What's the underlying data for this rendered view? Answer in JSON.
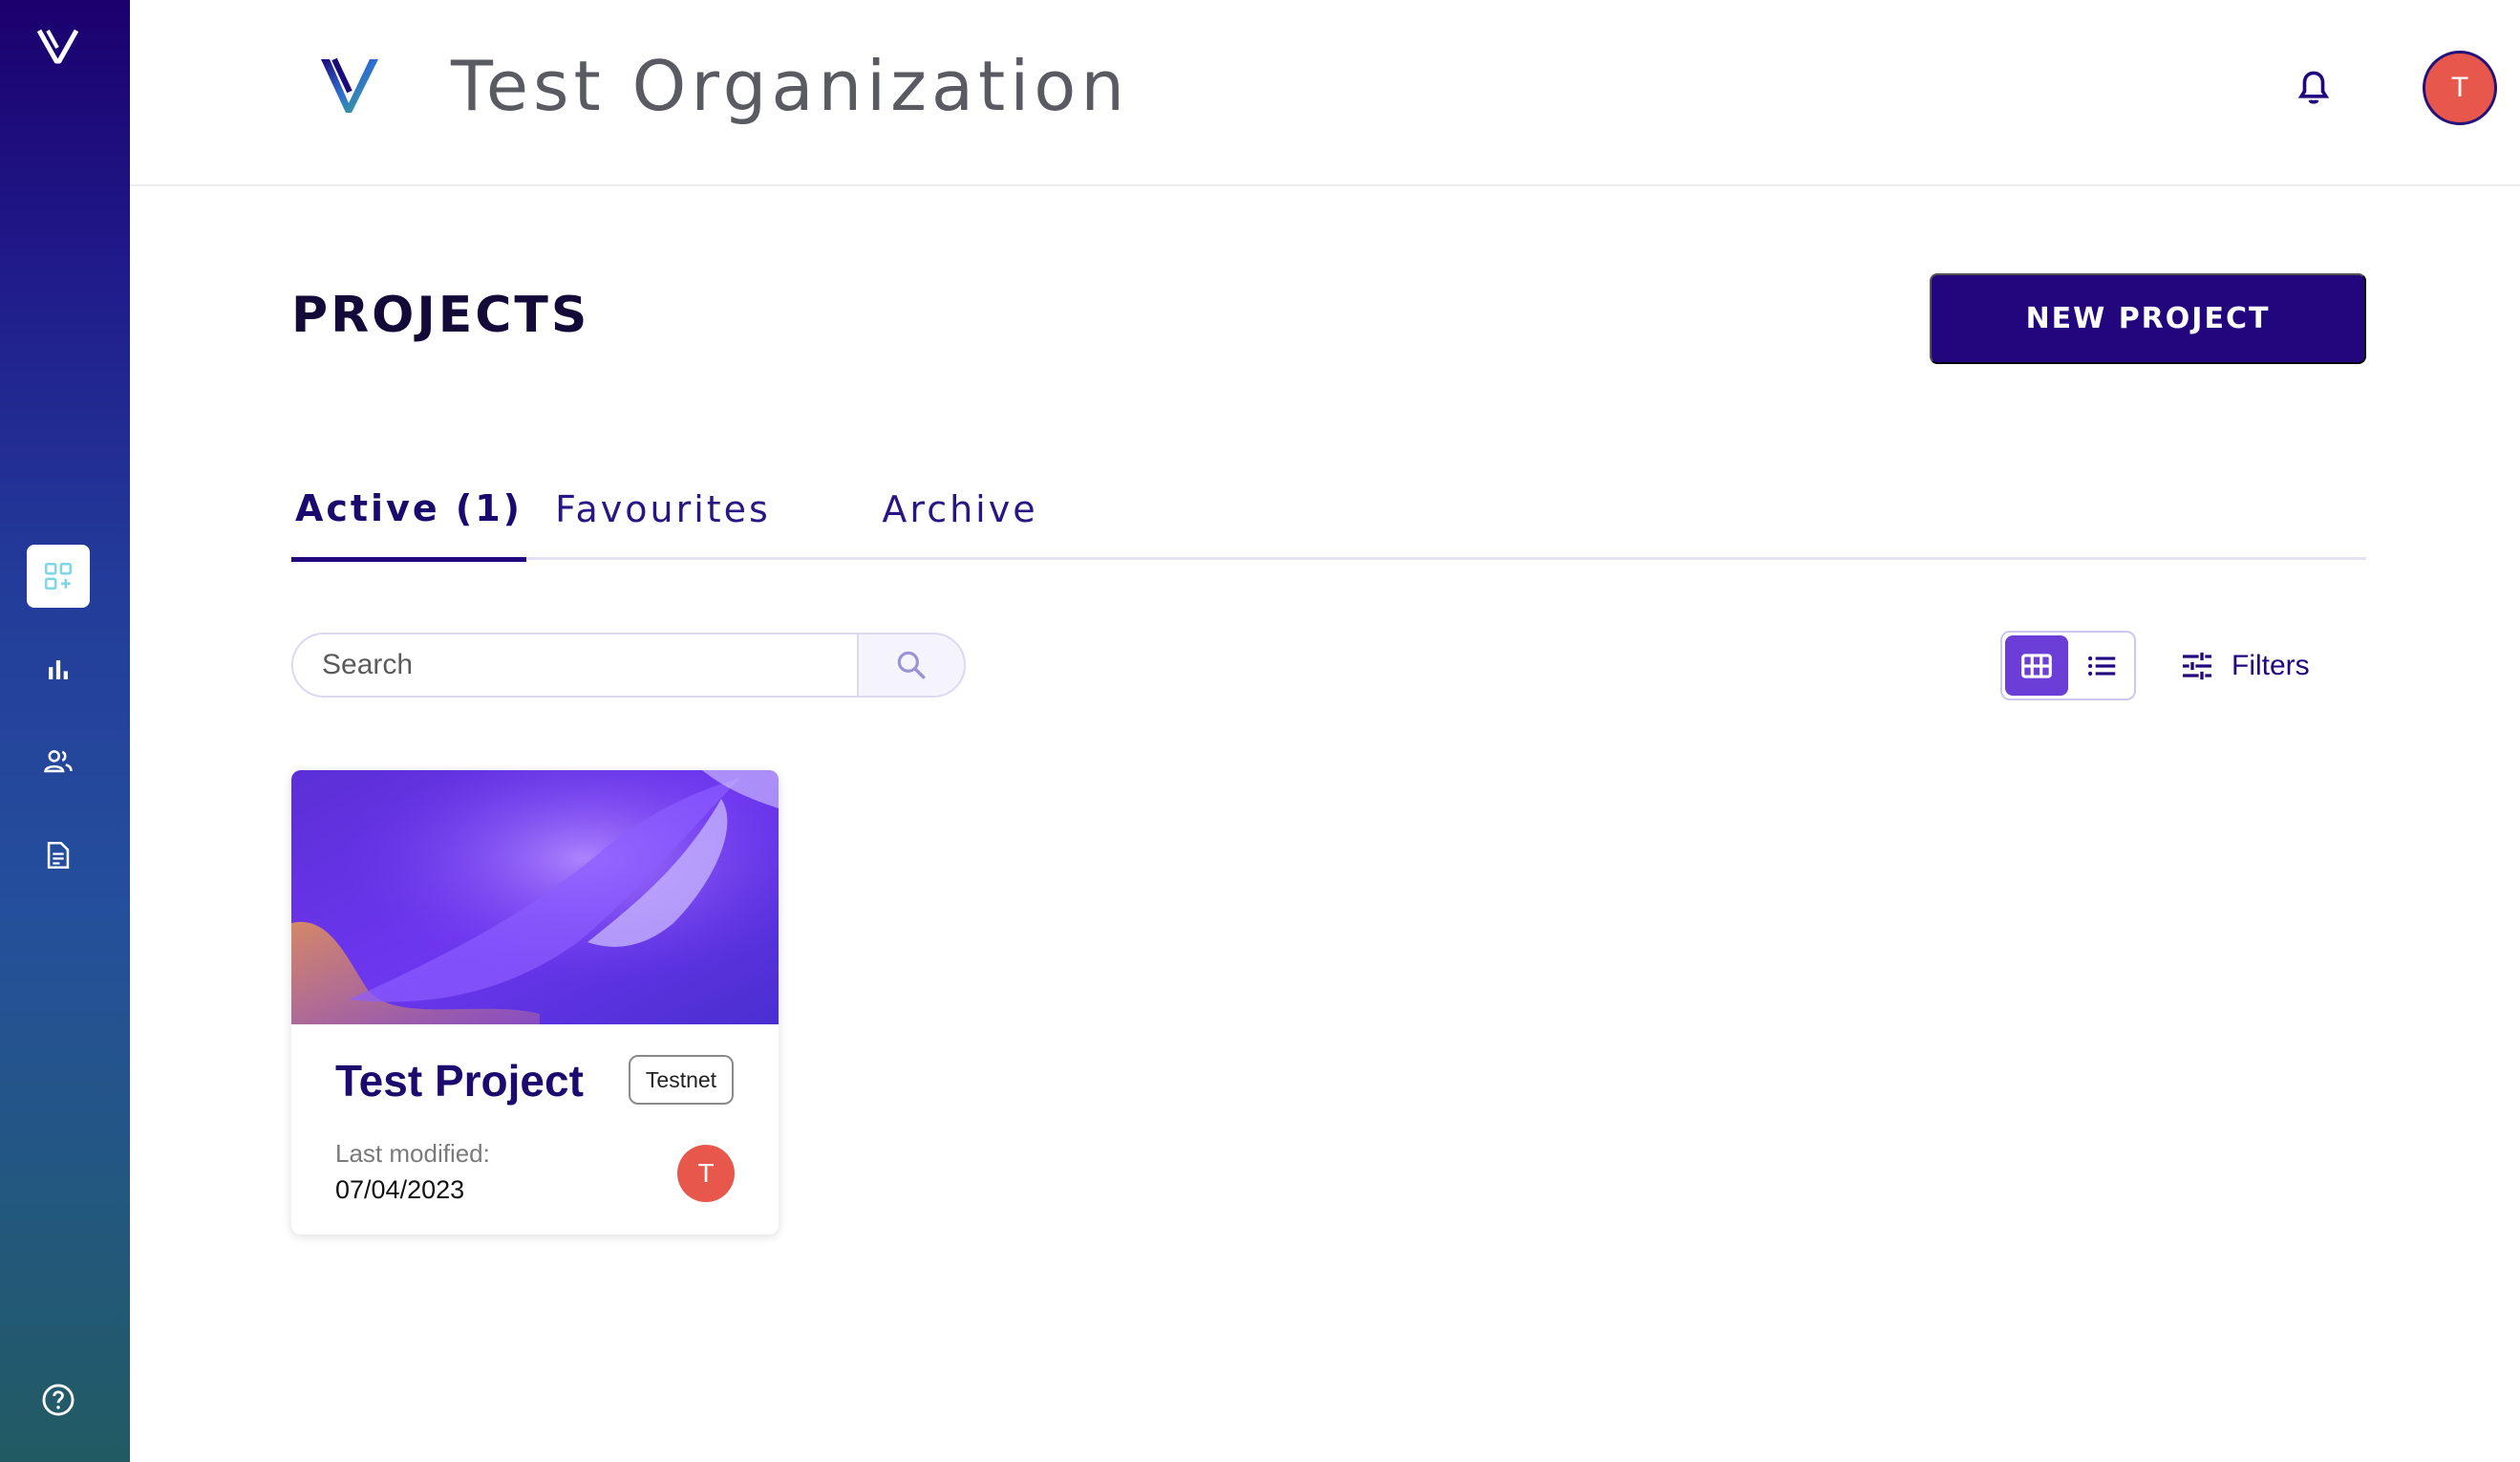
{
  "colors": {
    "primary": "#22067e",
    "accent_toggle": "#6c3ed8",
    "avatar": "#e8574c",
    "sidebar_active_icon": "#7fd6e6"
  },
  "sidebar": {
    "logo_icon": "v-logo-icon",
    "items": [
      {
        "name": "projects",
        "icon": "dashboard-add-icon",
        "active": true
      },
      {
        "name": "analytics",
        "icon": "bar-chart-icon",
        "active": false
      },
      {
        "name": "team",
        "icon": "people-icon",
        "active": false
      },
      {
        "name": "documents",
        "icon": "document-icon",
        "active": false
      }
    ],
    "help_icon": "help-circle-icon"
  },
  "header": {
    "org_name": "Test Organization",
    "user_initial": "T"
  },
  "page": {
    "title": "PROJECTS",
    "new_project_label": "NEW PROJECT"
  },
  "tabs": [
    {
      "label": "Active (1)",
      "active": true
    },
    {
      "label": "Favourites",
      "active": false
    },
    {
      "label": "Archive",
      "active": false
    }
  ],
  "search": {
    "placeholder": "Search",
    "value": ""
  },
  "view": {
    "selected": "grid"
  },
  "filters_label": "Filters",
  "projects": [
    {
      "title": "Test Project",
      "network": "Testnet",
      "last_modified_label": "Last modified:",
      "last_modified": "07/04/2023",
      "owner_initial": "T"
    }
  ]
}
